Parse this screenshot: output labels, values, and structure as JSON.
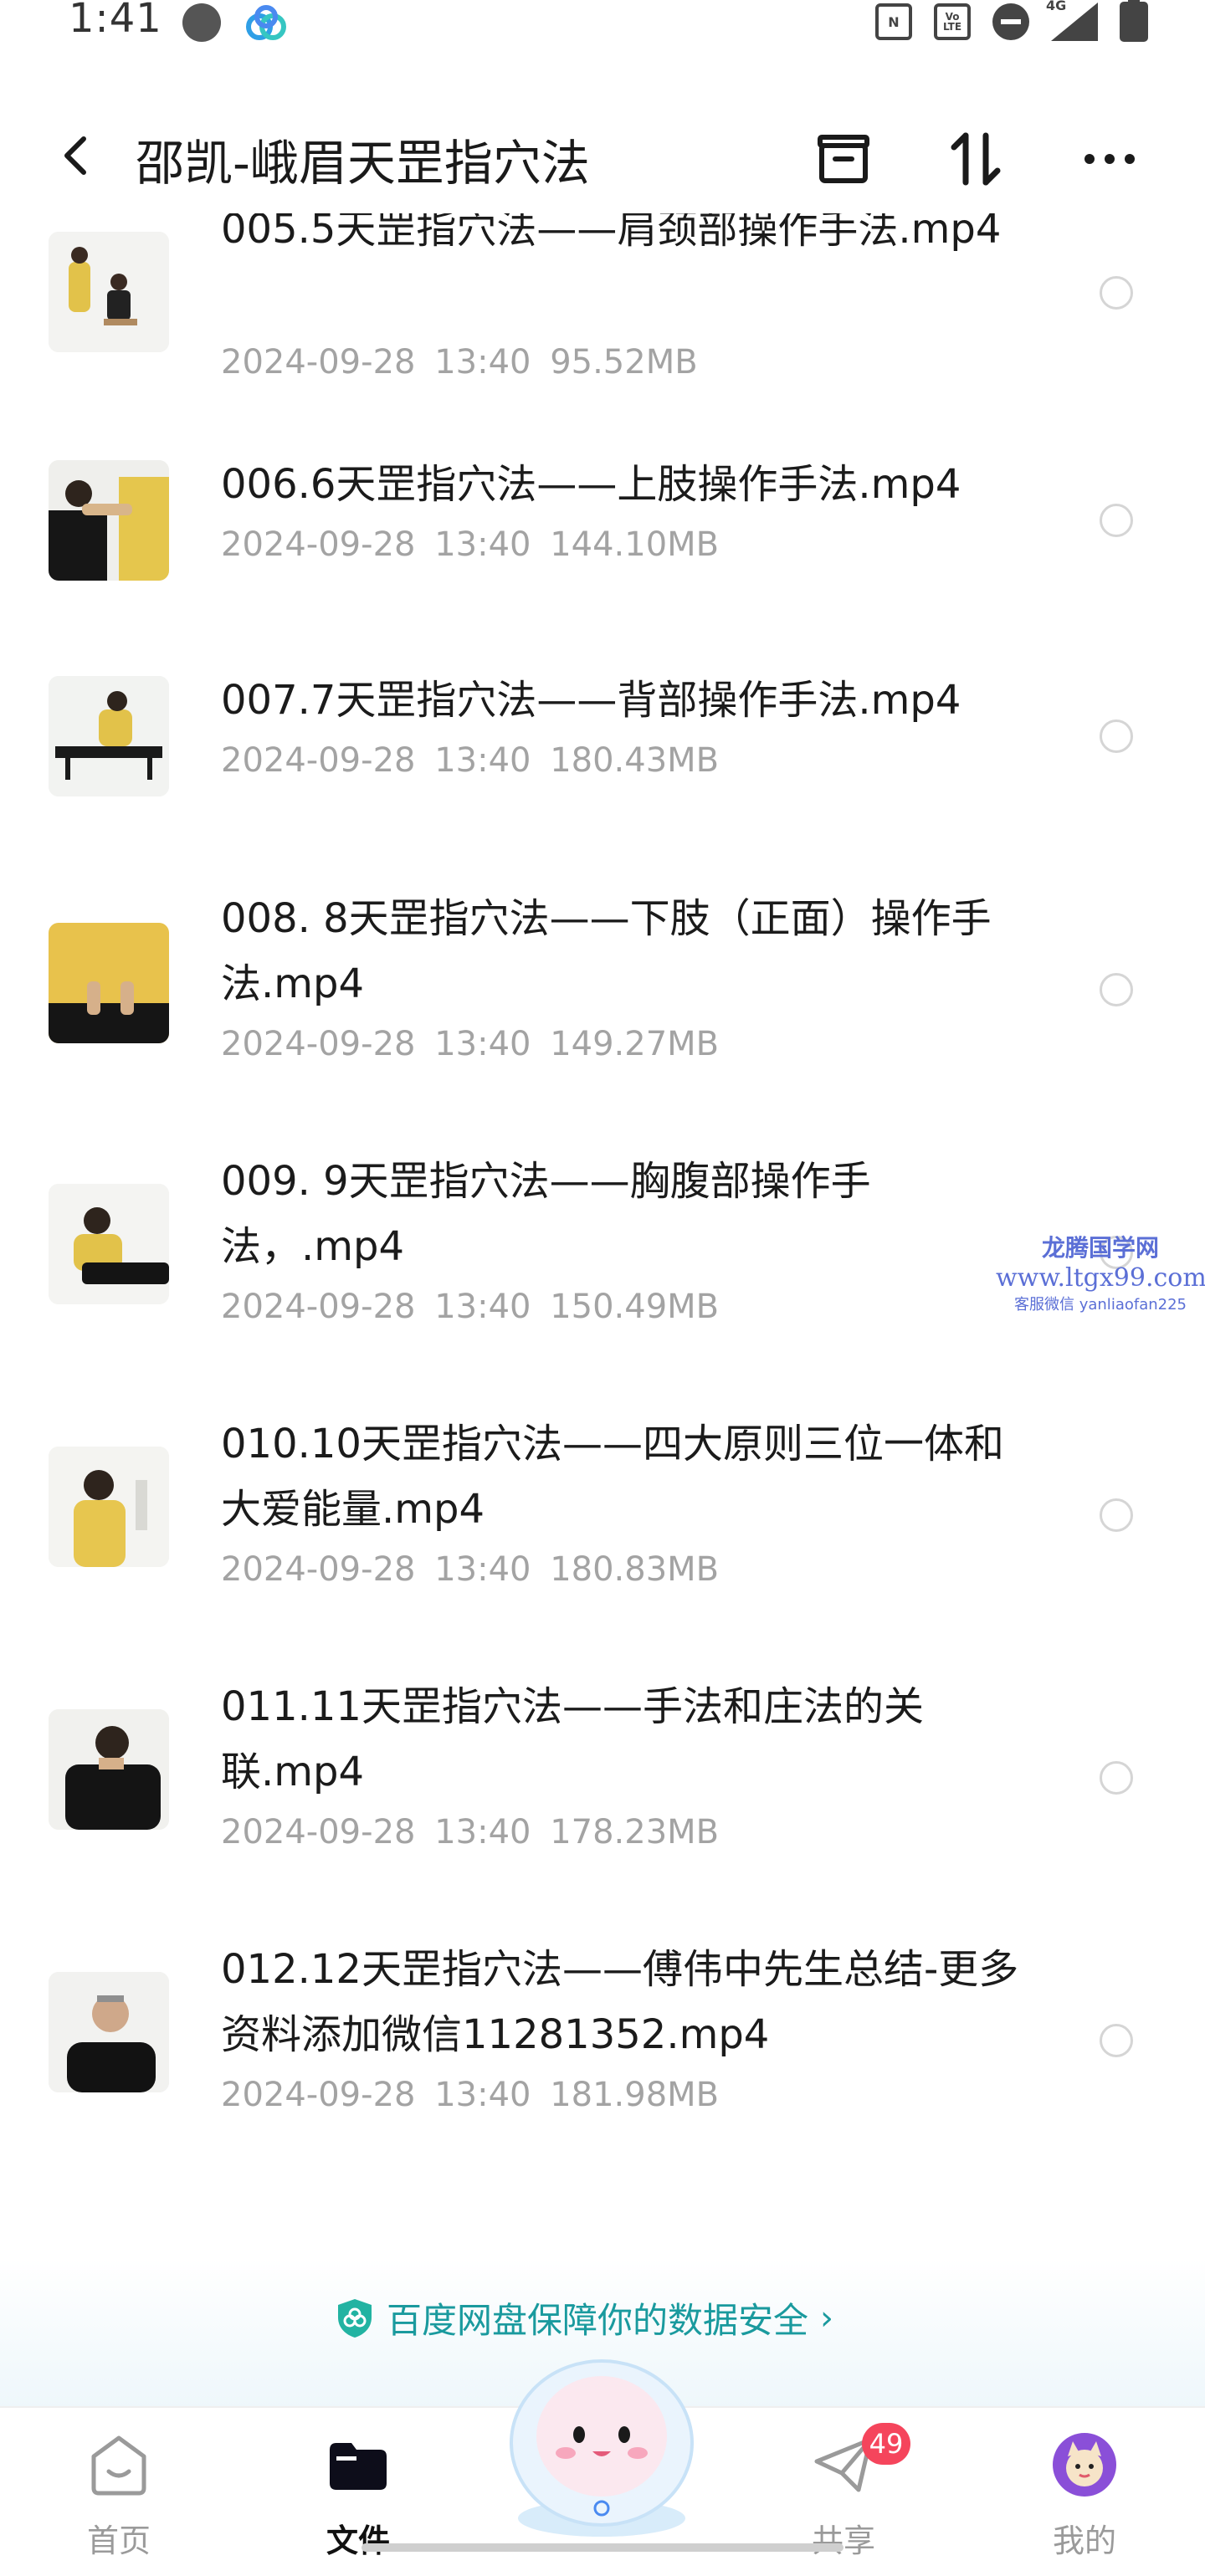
{
  "status_bar": {
    "time": "1:41",
    "lte_label": "Vo LTE",
    "network": "4G"
  },
  "header": {
    "title": "邵凯-峨眉天罡指穴法"
  },
  "files": [
    {
      "name": "005.5天罡指穴法——肩颈部操作手法.mp4",
      "date": "2024-09-28",
      "time": "13:40",
      "size": "95.52MB"
    },
    {
      "name": "006.6天罡指穴法——上肢操作手法.mp4",
      "date": "2024-09-28",
      "time": "13:40",
      "size": "144.10MB"
    },
    {
      "name": "007.7天罡指穴法——背部操作手法.mp4",
      "date": "2024-09-28",
      "time": "13:40",
      "size": "180.43MB"
    },
    {
      "name": "008. 8天罡指穴法——下肢（正面）操作手法.mp4",
      "date": "2024-09-28",
      "time": "13:40",
      "size": "149.27MB"
    },
    {
      "name": "009. 9天罡指穴法——胸腹部操作手法，.mp4",
      "date": "2024-09-28",
      "time": "13:40",
      "size": "150.49MB"
    },
    {
      "name": "010.10天罡指穴法——四大原则三位一体和大爱能量.mp4",
      "date": "2024-09-28",
      "time": "13:40",
      "size": "180.83MB"
    },
    {
      "name": "011.11天罡指穴法——手法和庄法的关联.mp4",
      "date": "2024-09-28",
      "time": "13:40",
      "size": "178.23MB"
    },
    {
      "name": "012.12天罡指穴法——傅伟中先生总结-更多资料添加微信11281352.mp4",
      "date": "2024-09-28",
      "time": "13:40",
      "size": "181.98MB"
    }
  ],
  "watermark": {
    "line1": "龙腾国学网",
    "line2": "www.ltgx99.com",
    "line3": "客服微信 yanliaofan225"
  },
  "banner": {
    "text": "百度网盘保障你的数据安全",
    "chevron": "›"
  },
  "tabs": [
    {
      "label": "首页",
      "icon": "home-icon",
      "active": false
    },
    {
      "label": "文件",
      "icon": "folder-icon",
      "active": true
    },
    {
      "label": "共享",
      "icon": "send-icon",
      "active": false,
      "badge": "49"
    },
    {
      "label": "我的",
      "icon": "avatar-icon",
      "active": false
    }
  ],
  "colors": {
    "accent_teal": "#1a9a9e",
    "badge_red": "#f5455c",
    "meta_gray": "#a3a3a3"
  }
}
